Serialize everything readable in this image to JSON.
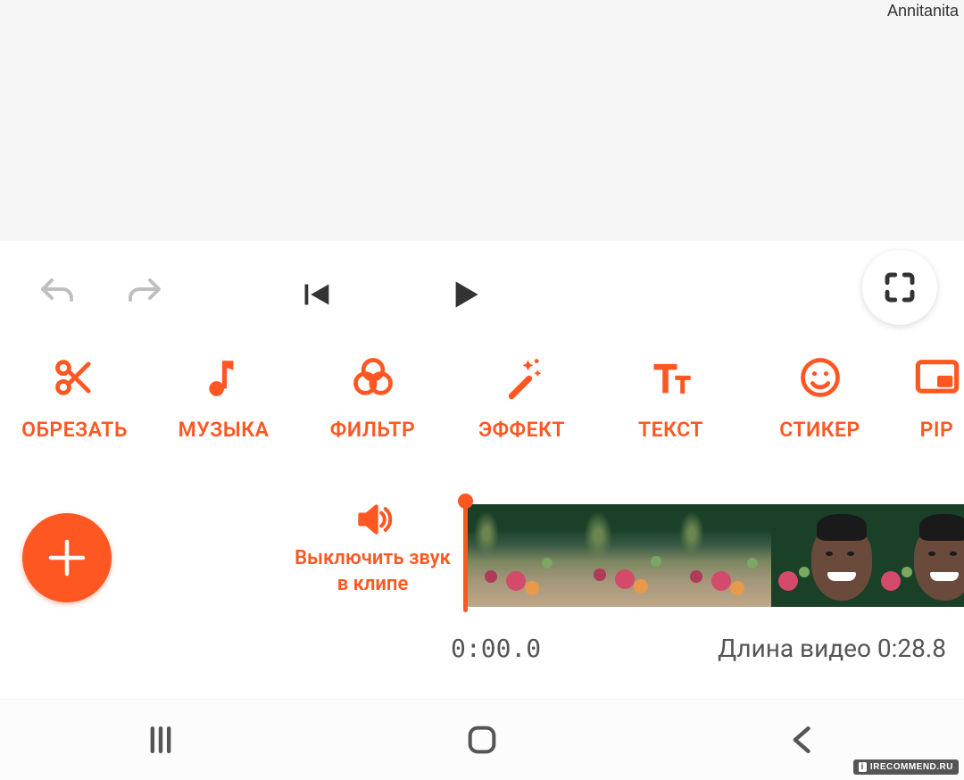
{
  "watermark": {
    "user": "Annitanita",
    "site_prefix": "i",
    "site": "IRECOMMEND.RU"
  },
  "tools": [
    {
      "id": "cut",
      "label": "ОБРЕЗАТЬ"
    },
    {
      "id": "music",
      "label": "МУЗЫКА"
    },
    {
      "id": "filter",
      "label": "ФИЛЬТР"
    },
    {
      "id": "effect",
      "label": "ЭФФЕКТ"
    },
    {
      "id": "text",
      "label": "ТЕКСТ"
    },
    {
      "id": "sticker",
      "label": "СТИКЕР"
    },
    {
      "id": "pip",
      "label": "PIP"
    }
  ],
  "mute": {
    "label": "Выключить звук в клипе"
  },
  "playback": {
    "current_time": "0:00.0",
    "duration_label": "Длина видео 0:28.8"
  },
  "colors": {
    "accent": "#ff5722"
  }
}
